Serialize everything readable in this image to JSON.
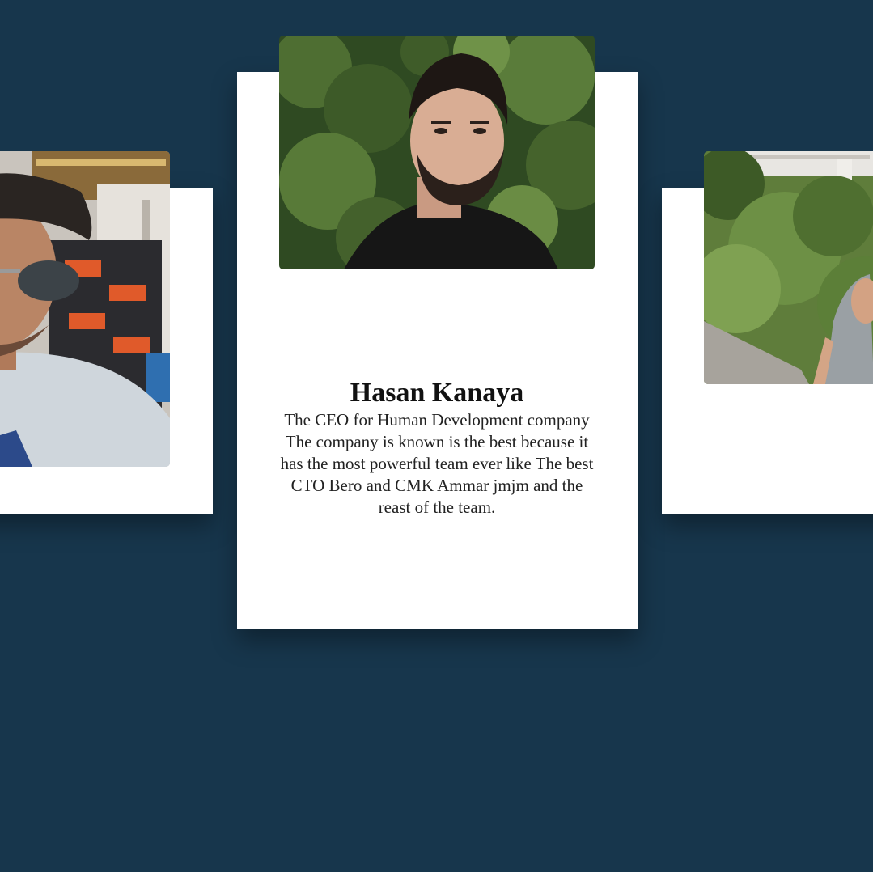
{
  "carousel": {
    "background_color": "#17364c",
    "card_color": "#ffffff",
    "cards": [
      {
        "position": "left",
        "photo_icon": "profile-photo-sunglasses-man"
      },
      {
        "position": "center",
        "photo_icon": "profile-photo-bearded-man",
        "name": "Hasan Kanaya",
        "bio": "The CEO for Human Development company The company is known is the best because it has the most powerful team ever like The best CTO Bero and CMK Ammar jmjm and the reast of the team."
      },
      {
        "position": "right",
        "photo_icon": "profile-photo-man-outdoors"
      }
    ]
  }
}
